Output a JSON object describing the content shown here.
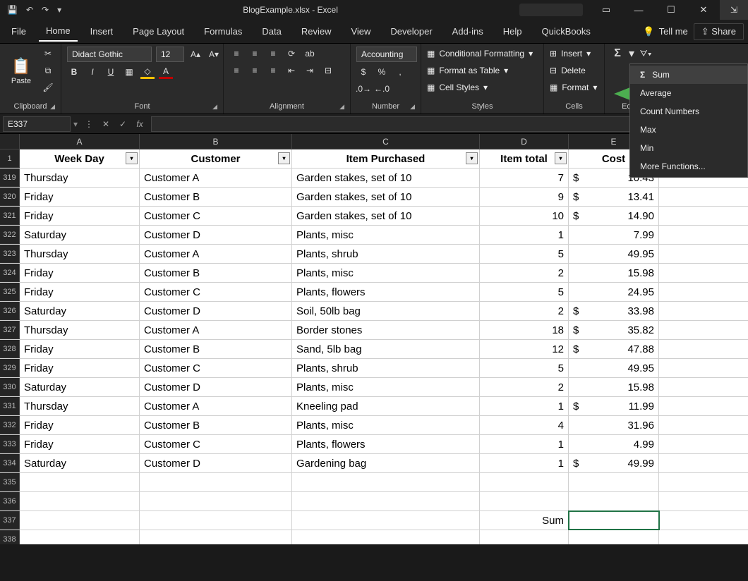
{
  "title": "BlogExample.xlsx - Excel",
  "qat": {
    "save": "💾",
    "undo": "↶",
    "redo": "↷"
  },
  "winbtns": {
    "ribbon": "▭",
    "min": "—",
    "max": "☐",
    "close": "✕"
  },
  "tabs": [
    "File",
    "Home",
    "Insert",
    "Page Layout",
    "Formulas",
    "Data",
    "Review",
    "View",
    "Developer",
    "Add-ins",
    "Help",
    "QuickBooks"
  ],
  "tellme": "Tell me",
  "share": "Share",
  "ribbon": {
    "clipboard": {
      "label": "Clipboard",
      "paste": "Paste"
    },
    "font": {
      "label": "Font",
      "name": "Didact Gothic",
      "size": "12",
      "bold": "B",
      "italic": "I",
      "underline": "U"
    },
    "alignment": {
      "label": "Alignment"
    },
    "number": {
      "label": "Number",
      "format": "Accounting"
    },
    "styles": {
      "label": "Styles",
      "cond": "Conditional Formatting",
      "table": "Format as Table",
      "cell": "Cell Styles"
    },
    "cells": {
      "label": "Cells",
      "insert": "Insert",
      "delete": "Delete",
      "format": "Format"
    },
    "editing": {
      "label": "Editing"
    }
  },
  "autosum": [
    "Sum",
    "Average",
    "Count Numbers",
    "Max",
    "Min",
    "More Functions..."
  ],
  "namebox": "E337",
  "columns": [
    "A",
    "B",
    "C",
    "D",
    "E"
  ],
  "headers": [
    "Week Day",
    "Customer",
    "Item Purchased",
    "Item total",
    "Cost"
  ],
  "firstRowNum": 1,
  "rowNums": [
    319,
    320,
    321,
    322,
    323,
    324,
    325,
    326,
    327,
    328,
    329,
    330,
    331,
    332,
    333,
    334,
    335,
    336,
    337,
    338
  ],
  "rows": [
    {
      "day": "Thursday",
      "cust": "Customer A",
      "item": "Garden stakes, set of 10",
      "qty": "7",
      "cur": "$",
      "cost": "10.43"
    },
    {
      "day": "Friday",
      "cust": "Customer B",
      "item": "Garden stakes, set of 10",
      "qty": "9",
      "cur": "$",
      "cost": "13.41"
    },
    {
      "day": "Friday",
      "cust": "Customer C",
      "item": "Garden stakes, set of 10",
      "qty": "10",
      "cur": "$",
      "cost": "14.90"
    },
    {
      "day": "Saturday",
      "cust": "Customer D",
      "item": "Plants, misc",
      "qty": "1",
      "cur": "",
      "cost": "7.99"
    },
    {
      "day": "Thursday",
      "cust": "Customer A",
      "item": "Plants, shrub",
      "qty": "5",
      "cur": "",
      "cost": "49.95"
    },
    {
      "day": "Friday",
      "cust": "Customer B",
      "item": "Plants, misc",
      "qty": "2",
      "cur": "",
      "cost": "15.98"
    },
    {
      "day": "Friday",
      "cust": "Customer C",
      "item": "Plants, flowers",
      "qty": "5",
      "cur": "",
      "cost": "24.95"
    },
    {
      "day": "Saturday",
      "cust": "Customer D",
      "item": "Soil, 50lb bag",
      "qty": "2",
      "cur": "$",
      "cost": "33.98"
    },
    {
      "day": "Thursday",
      "cust": "Customer A",
      "item": "Border stones",
      "qty": "18",
      "cur": "$",
      "cost": "35.82"
    },
    {
      "day": "Friday",
      "cust": "Customer B",
      "item": "Sand, 5lb bag",
      "qty": "12",
      "cur": "$",
      "cost": "47.88"
    },
    {
      "day": "Friday",
      "cust": "Customer C",
      "item": "Plants, shrub",
      "qty": "5",
      "cur": "",
      "cost": "49.95"
    },
    {
      "day": "Saturday",
      "cust": "Customer D",
      "item": "Plants, misc",
      "qty": "2",
      "cur": "",
      "cost": "15.98"
    },
    {
      "day": "Thursday",
      "cust": "Customer A",
      "item": "Kneeling pad",
      "qty": "1",
      "cur": "$",
      "cost": "11.99"
    },
    {
      "day": "Friday",
      "cust": "Customer B",
      "item": "Plants, misc",
      "qty": "4",
      "cur": "",
      "cost": "31.96"
    },
    {
      "day": "Friday",
      "cust": "Customer C",
      "item": "Plants, flowers",
      "qty": "1",
      "cur": "",
      "cost": "4.99"
    },
    {
      "day": "Saturday",
      "cust": "Customer D",
      "item": "Gardening bag",
      "qty": "1",
      "cur": "$",
      "cost": "49.99"
    }
  ],
  "sumLabel": "Sum"
}
